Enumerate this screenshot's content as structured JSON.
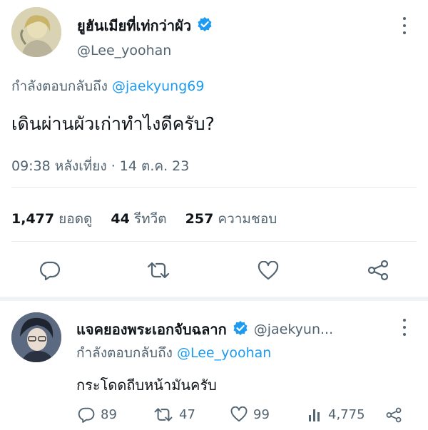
{
  "main_tweet": {
    "author_name": "ยูฮันเมียที่เท่กว่าผัว",
    "author_handle": "@Lee_yoohan",
    "reply_prefix": "กำลังตอบกลับถึง",
    "reply_to": "@jaekyung69",
    "text": "เดินผ่านผัวเก่าทำไงดีครับ?",
    "timestamp": "09:38 หลังเที่ยง · 14 ต.ค. 23",
    "stats": {
      "views_count": "1,477",
      "views_label": "ยอดดู",
      "retweets_count": "44",
      "retweets_label": "รีทวีต",
      "likes_count": "257",
      "likes_label": "ความชอบ"
    },
    "actions": [
      "reply-icon",
      "retweet-icon",
      "like-icon",
      "share-icon"
    ]
  },
  "reply_tweet": {
    "author_name": "แจคยองพระเอกจับฉลาก",
    "author_handle": "@jaekyun...",
    "reply_prefix": "กำลังตอบกลับถึง",
    "reply_to": "@Lee_yoohan",
    "text": "กระโดดถีบหน้ามันครับ",
    "actions": {
      "replies": "89",
      "retweets": "47",
      "likes": "99",
      "views": "4,775"
    }
  },
  "colors": {
    "accent": "#1d9bf0",
    "text": "#0f1419",
    "muted": "#536471",
    "divider": "#e6eaed"
  }
}
